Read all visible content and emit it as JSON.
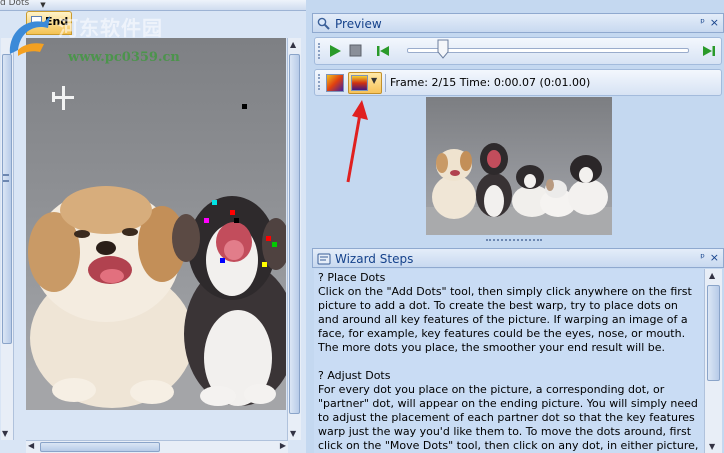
{
  "app": {
    "top_strip_label": "d Dots",
    "document_tab": "End",
    "watermark_text": "河东软件园",
    "watermark_url": "www.pc0359.cn"
  },
  "preview": {
    "title": "Preview",
    "pin_label": "ᵖ",
    "close_label": "×",
    "playback_position": 0.11,
    "frame_label": "Frame:",
    "frame_current": "2/15",
    "time_label": "Time:",
    "time_current": "0:00.07",
    "time_total": "(0:01.00)"
  },
  "wizard": {
    "title": "Wizard Steps",
    "pin_label": "ᵖ",
    "close_label": "×",
    "paragraphs": [
      "? Place Dots\nClick on the \"Add Dots\" tool, then simply click anywhere on the first picture to add a dot.  To create the best warp, try to place dots on and around all key features of the picture.  If warping an image of a face, for example, key features could be the eyes, nose, or mouth.  The more dots you place, the smoother your end result will be.",
      "? Adjust Dots\nFor every dot you place on the picture, a corresponding dot, or \"partner\" dot, will appear on the ending picture.  You will simply need to adjust the placement of each partner dot so that the key features warp just the way you'd like them to.  To move the dots around, first click on the \"Move Dots\" tool, then click on any dot, in either picture, and notice that the dot and its partner will both be"
    ]
  },
  "icons": {
    "play": "play-icon",
    "stop": "stop-icon",
    "prev": "previous-frame-icon",
    "next": "next-frame-icon",
    "preview": "magnifier-icon",
    "wizard": "wizard-icon"
  },
  "colors": {
    "pane_title": "#15428b",
    "accent_orange": "#f8c45b",
    "play_green": "#2a9a2a",
    "arrow_red": "#e02020"
  },
  "dots": [
    {
      "color": "#000000"
    },
    {
      "color": "#00e5e5"
    },
    {
      "color": "#ff00ff"
    },
    {
      "color": "#ff0000"
    },
    {
      "color": "#ff0000"
    },
    {
      "color": "#00cc00"
    },
    {
      "color": "#0000ff"
    },
    {
      "color": "#ffff00"
    },
    {
      "color": "#000000"
    }
  ]
}
